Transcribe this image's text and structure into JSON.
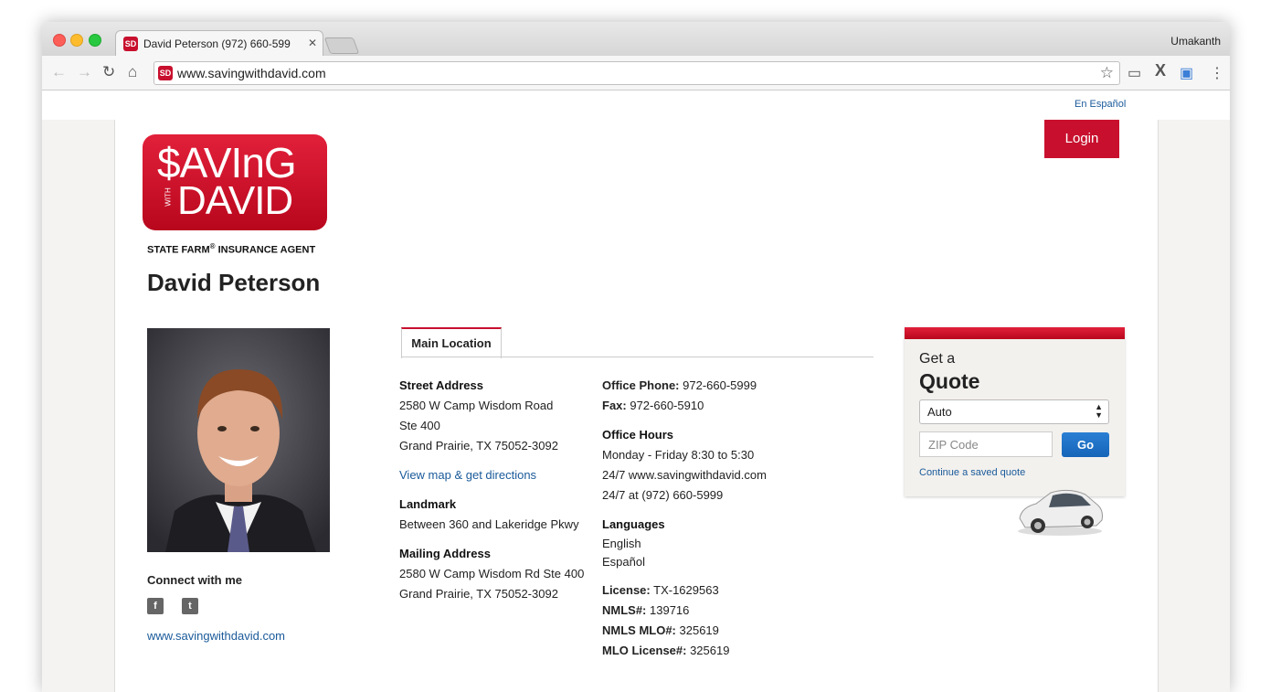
{
  "browser": {
    "tab_title": "David Peterson (972) 660-599",
    "tab_favicon_text": "SD",
    "user": "Umakanth",
    "url": "www.savingwithdavid.com"
  },
  "header": {
    "espanol_link": "En Español",
    "login_label": "Login",
    "logo_top": "$AVInG",
    "logo_with": "WITH",
    "logo_bottom": "DAVID",
    "agent_label": "STATE FARM",
    "agent_label_reg": "®",
    "agent_label_suffix": " INSURANCE AGENT",
    "agent_name": "David Peterson"
  },
  "profile": {
    "connect_label": "Connect with me",
    "facebook_icon": "f",
    "twitter_icon": "t",
    "website_link": "www.savingwithdavid.com"
  },
  "location": {
    "tab_label": "Main Location",
    "street_label": "Street Address",
    "street_lines": [
      "2580 W Camp Wisdom Road",
      "Ste 400",
      "Grand Prairie, TX 75052-3092"
    ],
    "map_link": "View map & get directions",
    "landmark_label": "Landmark",
    "landmark_value": "Between 360 and Lakeridge Pkwy",
    "mailing_label": "Mailing Address",
    "mailing_lines": [
      "2580 W Camp Wisdom Rd Ste 400",
      "Grand Prairie, TX 75052-3092"
    ],
    "phone_label": "Office Phone:",
    "phone_value": " 972-660-5999",
    "fax_label": "Fax:",
    "fax_value": " 972-660-5910",
    "hours_label": "Office Hours",
    "hours_lines": [
      "Monday - Friday 8:30 to 5:30",
      "24/7 www.savingwithdavid.com",
      "24/7 at (972) 660-5999"
    ],
    "languages_label": "Languages",
    "languages": [
      "English",
      "Español"
    ],
    "license_label": "License:",
    "license_value": " TX-1629563",
    "nmls_label": "NMLS#:",
    "nmls_value": " 139716",
    "nmls_mlo_label": "NMLS MLO#:",
    "nmls_mlo_value": " 325619",
    "mlo_license_label": "MLO License#:",
    "mlo_license_value": " 325619"
  },
  "quote": {
    "get_a": "Get a",
    "quote": "Quote",
    "selected_product": "Auto",
    "zip_placeholder": "ZIP Code",
    "go_label": "Go",
    "continue_link": "Continue a saved quote"
  },
  "colors": {
    "brand_red": "#c8102e",
    "link_blue": "#1a5a9a",
    "go_blue": "#1565b9"
  }
}
